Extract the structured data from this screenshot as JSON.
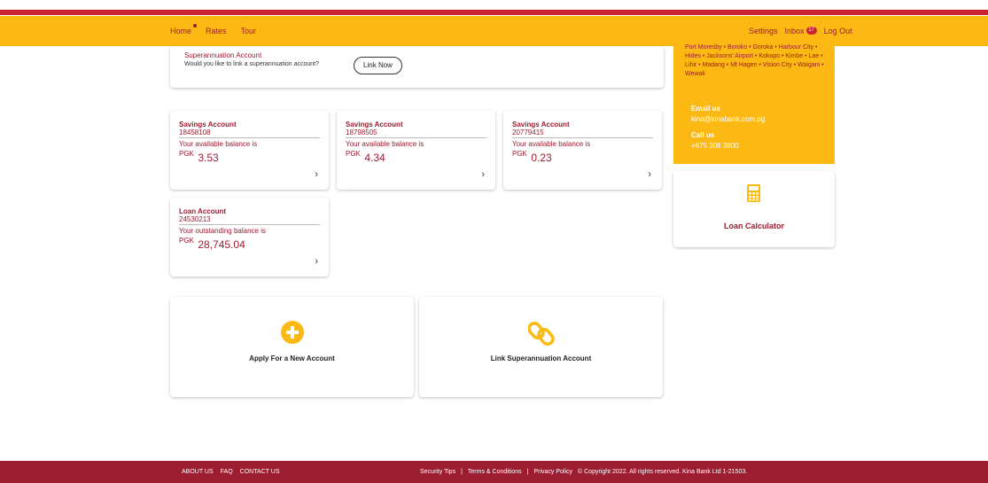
{
  "nav": {
    "home": "Home",
    "rates": "Rates",
    "tour": "Tour",
    "settings": "Settings",
    "inbox": "Inbox",
    "inbox_count": "17",
    "logout": "Log Out"
  },
  "superannuation": {
    "title": "Superannuation Account",
    "prompt": "Would you like to link a superannuation account?",
    "button": "Link Now"
  },
  "accounts": [
    {
      "type": "Savings Account",
      "number": "18458108",
      "balance_label": "Your available balance is",
      "currency": "PGK",
      "amount": "3.53"
    },
    {
      "type": "Savings Account",
      "number": "18798505",
      "balance_label": "Your available balance is",
      "currency": "PGK",
      "amount": "4.34"
    },
    {
      "type": "Savings Account",
      "number": "20779415",
      "balance_label": "Your available balance is",
      "currency": "PGK",
      "amount": "0.23"
    },
    {
      "type": "Loan Account",
      "number": "24530213",
      "balance_label": "Your outstanding balance is",
      "currency": "PGK",
      "amount": "28,745.04"
    }
  ],
  "sidebar": {
    "branches": "Port Moresby • Boroko • Goroka • Harbour City • Hides • Jacksons' Airport • Kokopo • Kimbe • Lae • Lihir • Madang • Mt Hagen • Vision City • Waigani • Wewak",
    "email_heading": "Email us",
    "email": "kina@kinabank.com.pg",
    "call_heading": "Call us",
    "phone": "+675 308 3800",
    "loan_calculator": "Loan Calculator"
  },
  "actions": {
    "apply": "Apply For a New Account",
    "link_super": "Link Superannuation Account"
  },
  "footer": {
    "about": "ABOUT US",
    "faq": "FAQ",
    "contact": "CONTACT US",
    "security": "Security Tips",
    "sep": "|",
    "terms": "Terms & Conditions",
    "privacy": "Privacy Policy",
    "copyright": "© Copyright 2022. All rights reserved. Kina Bank Ltd 1-21503."
  },
  "colors": {
    "brand_yellow": "#fdb913",
    "brand_maroon": "#9c1c30",
    "top_red": "#c8232f"
  },
  "icons": {
    "chevron": "chevron-right-icon",
    "calculator": "calculator-icon",
    "plus": "plus-circle-icon",
    "link": "link-icon"
  }
}
